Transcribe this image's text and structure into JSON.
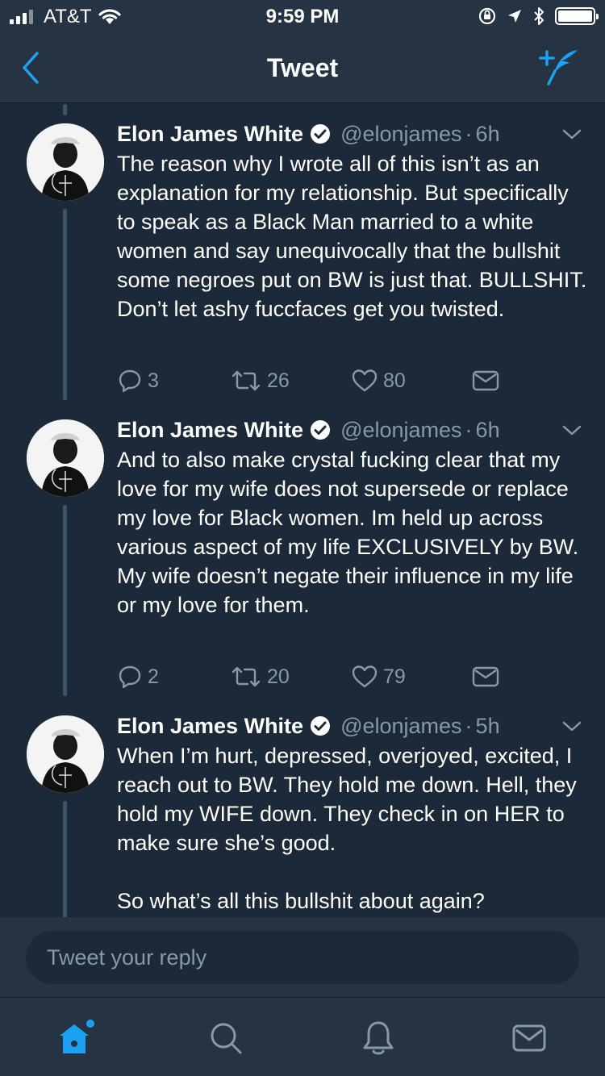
{
  "status_bar": {
    "carrier": "AT&T",
    "time": "9:59 PM"
  },
  "nav": {
    "title": "Tweet",
    "back_icon": "chevron-left-icon",
    "compose_icon": "compose-tweet-icon"
  },
  "colors": {
    "accent": "#1da1f2",
    "background": "#1c2939",
    "chrome": "#253342",
    "secondary_text": "#8899a6"
  },
  "tweets": [
    {
      "name": "Elon James White",
      "handle": "@elonjames",
      "separator": "·",
      "time": "6h",
      "text": "The reason why I wrote all of this isn’t as an explanation for my relationship. But specifically to speak as a Black Man married to a white women and say unequivocally that the bullshit some negroes put on BW is just that. BULLSHIT. Don’t let ashy fuccfaces  get you twisted.",
      "replies": "3",
      "retweets": "26",
      "likes": "80"
    },
    {
      "name": "Elon James White",
      "handle": "@elonjames",
      "separator": "·",
      "time": "6h",
      "text": "And to also make crystal fucking clear that my love for my wife does not supersede or replace my love for Black women. Im held up across various aspect of my life EXCLUSIVELY by BW. My wife doesn’t negate their influence in my life or my love for them.",
      "replies": "2",
      "retweets": "20",
      "likes": "79"
    },
    {
      "name": "Elon James White",
      "handle": "@elonjames",
      "separator": "·",
      "time": "5h",
      "text": "When I’m hurt, depressed, overjoyed, excited, I reach out to BW. They hold me down. Hell, they hold my WIFE down. They check in on HER to make sure she’s good.\n\nSo what’s all this bullshit about again?"
    }
  ],
  "reply": {
    "placeholder": "Tweet your reply"
  },
  "tabs": [
    {
      "icon": "home-icon",
      "active": true
    },
    {
      "icon": "search-icon",
      "active": false
    },
    {
      "icon": "notifications-bell-icon",
      "active": false
    },
    {
      "icon": "messages-envelope-icon",
      "active": false
    }
  ]
}
